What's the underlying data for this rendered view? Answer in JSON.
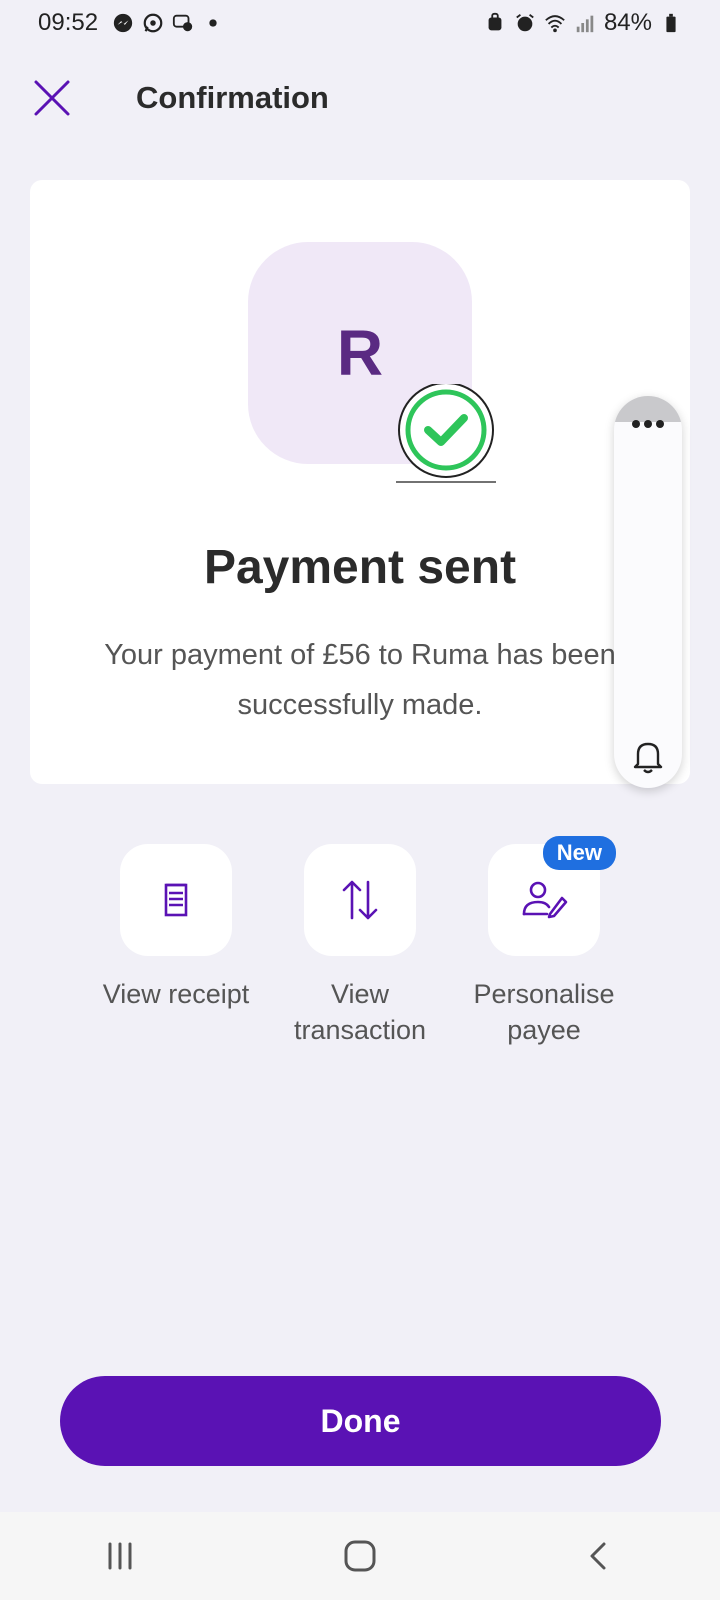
{
  "status_bar": {
    "time": "09:52",
    "battery": "84%",
    "left_icons": [
      "messenger-icon",
      "whatsapp-icon",
      "chat-icon",
      "dot-icon"
    ],
    "right_icons": [
      "vpn-icon",
      "alarm-icon",
      "wifi-icon",
      "signal-icon",
      "battery-icon"
    ]
  },
  "header": {
    "title": "Confirmation",
    "close_icon": "close-icon"
  },
  "card": {
    "avatar_letter": "R",
    "title": "Payment sent",
    "message": "Your payment of £56 to Ruma has been successfully made."
  },
  "side_panel": {
    "more_icon": "more-horizontal-icon",
    "bell_icon": "bell-icon"
  },
  "actions": [
    {
      "label": "View receipt",
      "icon": "receipt-icon"
    },
    {
      "label": "View transaction",
      "icon": "transfer-arrows-icon"
    },
    {
      "label": "Personalise payee",
      "icon": "user-edit-icon",
      "badge": "New"
    }
  ],
  "done_label": "Done",
  "colors": {
    "accent": "#5a12b4",
    "success": "#2ec55a",
    "badge": "#1f6fe0",
    "avatar_bg": "#f0e8f7"
  },
  "nav": [
    "recent-apps-icon",
    "home-icon",
    "back-icon"
  ]
}
